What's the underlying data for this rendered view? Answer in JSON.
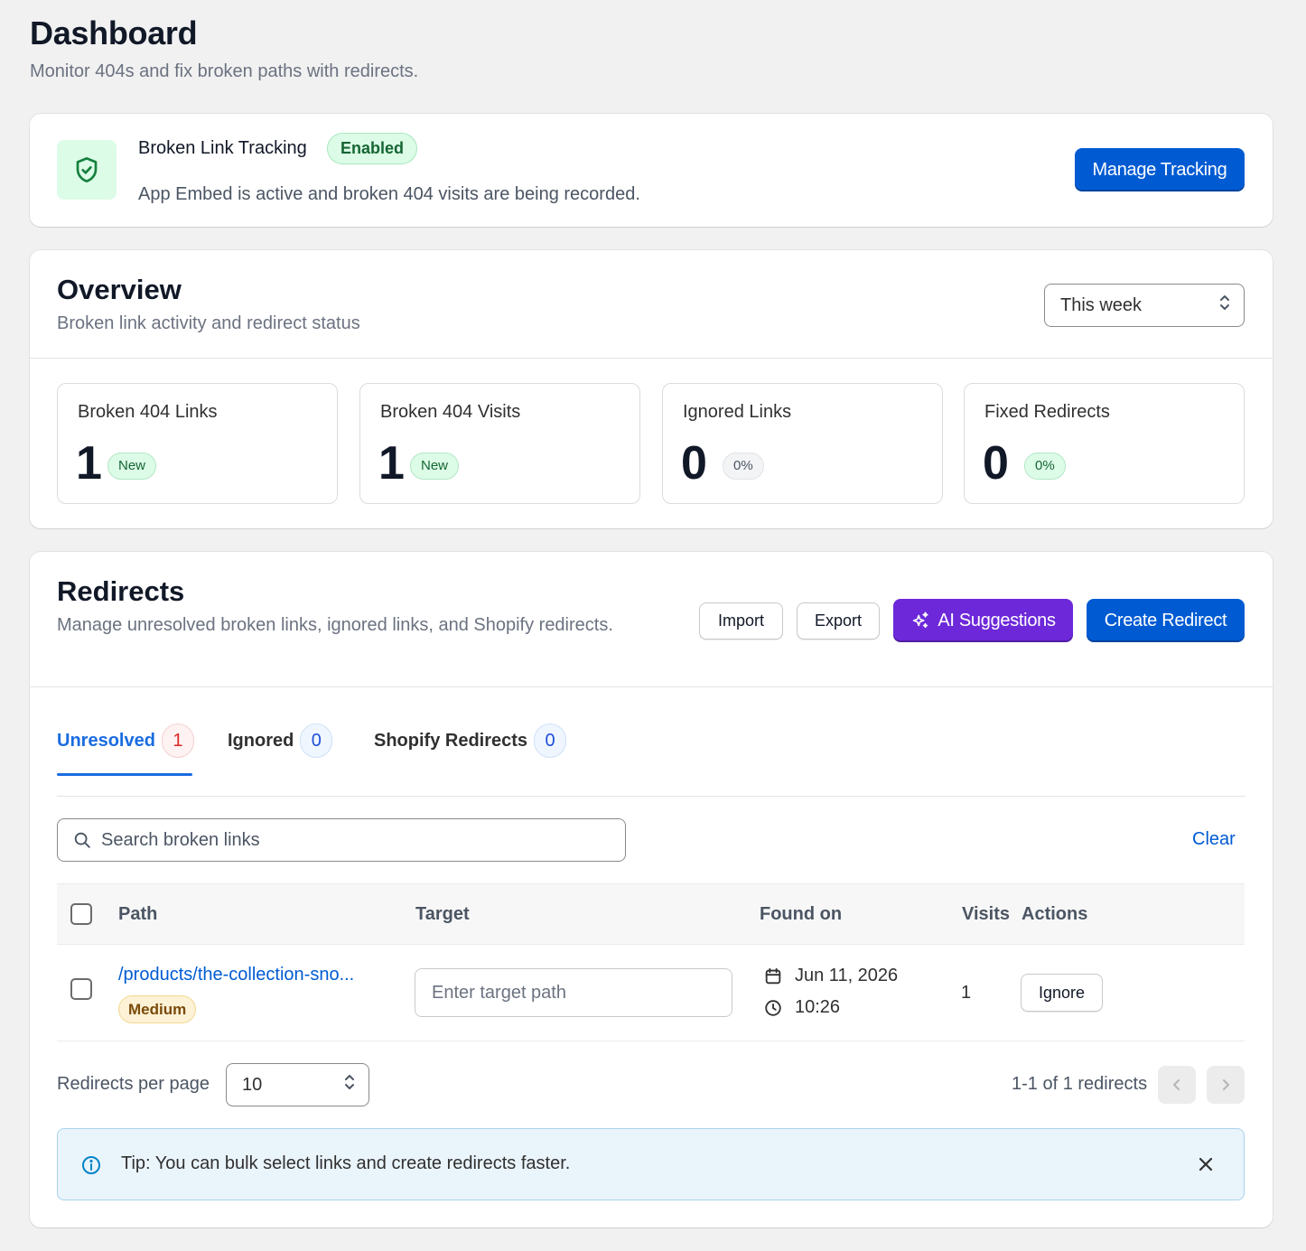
{
  "header": {
    "title": "Dashboard",
    "subtitle": "Monitor 404s and fix broken paths with redirects."
  },
  "tracking": {
    "title": "Broken Link Tracking",
    "status": "Enabled",
    "description": "App Embed is active and broken 404 visits are being recorded.",
    "button": "Manage Tracking",
    "icon": "shield-check-icon"
  },
  "overview": {
    "title": "Overview",
    "subtitle": "Broken link activity and redirect status",
    "period": "This week",
    "stats": [
      {
        "label": "Broken 404 Links",
        "value": "1",
        "badge": "New"
      },
      {
        "label": "Broken 404 Visits",
        "value": "1",
        "badge": "New"
      },
      {
        "label": "Ignored Links",
        "value": "0",
        "badge": "0%"
      },
      {
        "label": "Fixed Redirects",
        "value": "0",
        "badge": "0%"
      }
    ]
  },
  "redirects": {
    "title": "Redirects",
    "subtitle": "Manage unresolved broken links, ignored links, and Shopify redirects.",
    "buttons": {
      "import": "Import",
      "export": "Export",
      "ai": "AI Suggestions",
      "create": "Create Redirect"
    },
    "tabs": [
      {
        "label": "Unresolved",
        "count": "1"
      },
      {
        "label": "Ignored",
        "count": "0"
      },
      {
        "label": "Shopify Redirects",
        "count": "0"
      }
    ],
    "search": {
      "placeholder": "Search broken links",
      "clear": "Clear"
    },
    "columns": {
      "path": "Path",
      "target": "Target",
      "found_on": "Found on",
      "visits": "Visits",
      "actions": "Actions"
    },
    "rows": [
      {
        "path": "/products/the-collection-sno...",
        "priority": "Medium",
        "target_placeholder": "Enter target path",
        "date": "Jun 11, 2026",
        "time": "10:26",
        "visits": "1",
        "action": "Ignore"
      }
    ],
    "pagination": {
      "per_page_label": "Redirects per page",
      "per_page": "10",
      "info": "1-1 of 1 redirects"
    },
    "tip": "Tip: You can bulk select links and create redirects faster."
  },
  "colors": {
    "primary": "#005bd3",
    "ai": "#6d28d9",
    "success_bg": "#dcfce7",
    "tip_bg": "#eaf4fb"
  }
}
